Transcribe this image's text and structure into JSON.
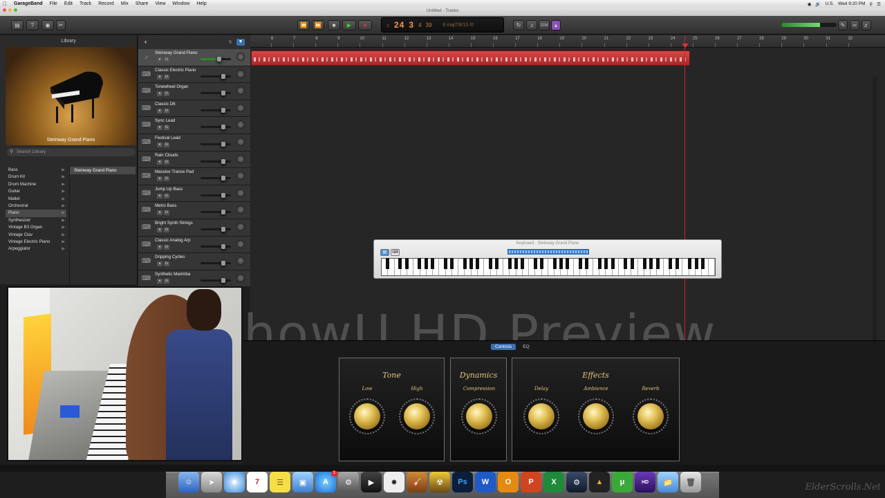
{
  "menubar": {
    "app": "GarageBand",
    "items": [
      "File",
      "Edit",
      "Track",
      "Record",
      "Mix",
      "Share",
      "View",
      "Window",
      "Help"
    ],
    "clock": "Wed 9:20 PM",
    "locale": "U.S."
  },
  "window_title": "Untitled - Tracks",
  "lcd": {
    "bar": "24",
    "beat": "3",
    "div": "4",
    "tick": "39",
    "key": "6 maj7/9/13 /0",
    "counter": "1234"
  },
  "master_volume_level": 0.7,
  "library": {
    "title": "Library",
    "image_caption": "Steinway Grand Piano",
    "search_placeholder": "Search Library",
    "categories": [
      "Bass",
      "Drum Kit",
      "Drum Machine",
      "Guitar",
      "Mallet",
      "Orchestral",
      "Piano",
      "Synthesizer",
      "Vintage B3 Organ",
      "Vintage Clav",
      "Vintage Electric Piano",
      "Arpeggiator"
    ],
    "selected_category": "Piano",
    "patches": [
      "Steinway Grand Piano"
    ]
  },
  "tracks": [
    {
      "name": "Steinway Grand Piano",
      "selected": true
    },
    {
      "name": "Classic Electric Piano"
    },
    {
      "name": "Tonewheel Organ"
    },
    {
      "name": "Classic D6"
    },
    {
      "name": "Sync Lead"
    },
    {
      "name": "Festival Lead"
    },
    {
      "name": "Rain Clouds"
    },
    {
      "name": "Massive Trance Pad"
    },
    {
      "name": "Jump Up Bass"
    },
    {
      "name": "Metro Bass"
    },
    {
      "name": "Bright Synth Strings"
    },
    {
      "name": "Classic Analog Arp"
    },
    {
      "name": "Dripping Cycles"
    },
    {
      "name": "Synthetic Marimba"
    }
  ],
  "ruler_bars": [
    "6",
    "7",
    "8",
    "9",
    "10",
    "11",
    "12",
    "13",
    "14",
    "15",
    "16",
    "17",
    "18",
    "19",
    "20",
    "21",
    "22",
    "23",
    "24",
    "25",
    "26",
    "27",
    "28",
    "29",
    "30",
    "31",
    "32"
  ],
  "keyboard_window": {
    "title": "Keyboard - Steinway Grand Piano"
  },
  "watermark": "howU HD Preview",
  "smart_controls": {
    "tabs": [
      "Controls",
      "EQ"
    ],
    "tone": {
      "title": "Tone",
      "low": "Low",
      "high": "High"
    },
    "dynamics": {
      "title": "Dynamics",
      "compression": "Compression"
    },
    "effects": {
      "title": "Effects",
      "delay": "Delay",
      "ambience": "Ambience",
      "reverb": "Reverb"
    }
  },
  "dock_corner": "ElderScrolls.Net"
}
